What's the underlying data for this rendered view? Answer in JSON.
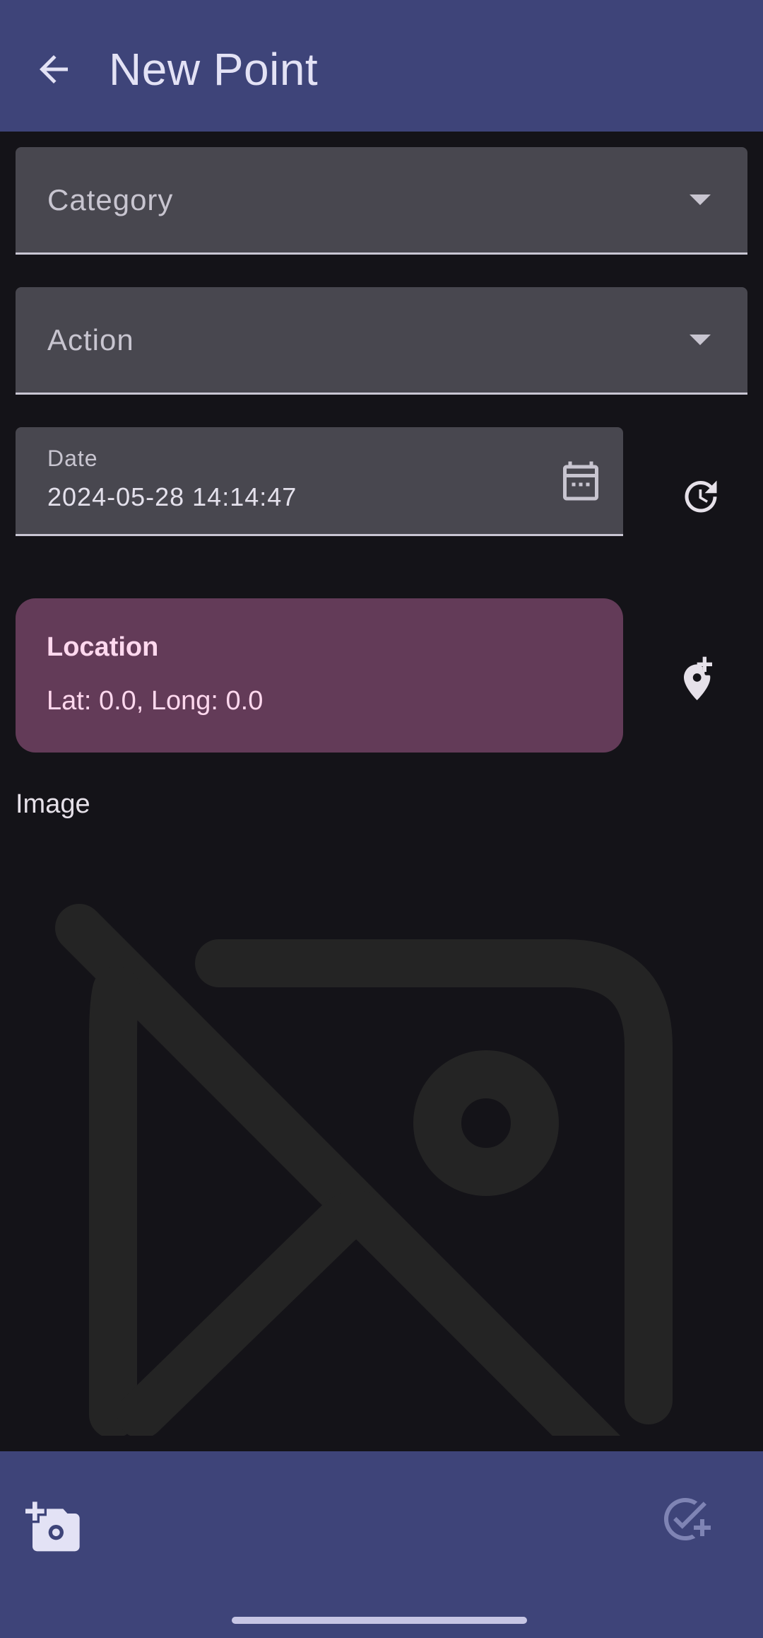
{
  "app_bar": {
    "title": "New Point",
    "back_icon": "arrow-back-icon"
  },
  "form": {
    "category": {
      "label": "Category",
      "icon": "dropdown-arrow-icon"
    },
    "action": {
      "label": "Action",
      "icon": "dropdown-arrow-icon"
    },
    "date": {
      "label": "Date",
      "value": "2024-05-28 14:14:47",
      "icon": "calendar-icon",
      "reset_icon": "update-clock-icon"
    },
    "location": {
      "title": "Location",
      "value": "Lat: 0.0, Long: 0.0",
      "add_icon": "add-location-icon"
    },
    "image": {
      "heading": "Image",
      "placeholder_icon": "hide-image-icon"
    }
  },
  "bottom_bar": {
    "camera_icon": "add-photo-camera-icon",
    "save_icon": "add-task-check-icon"
  },
  "colors": {
    "bar": "#3e4479",
    "background": "#141318",
    "field": "#48474f",
    "location_card": "#633b58",
    "location_text": "#ffd8ee"
  }
}
